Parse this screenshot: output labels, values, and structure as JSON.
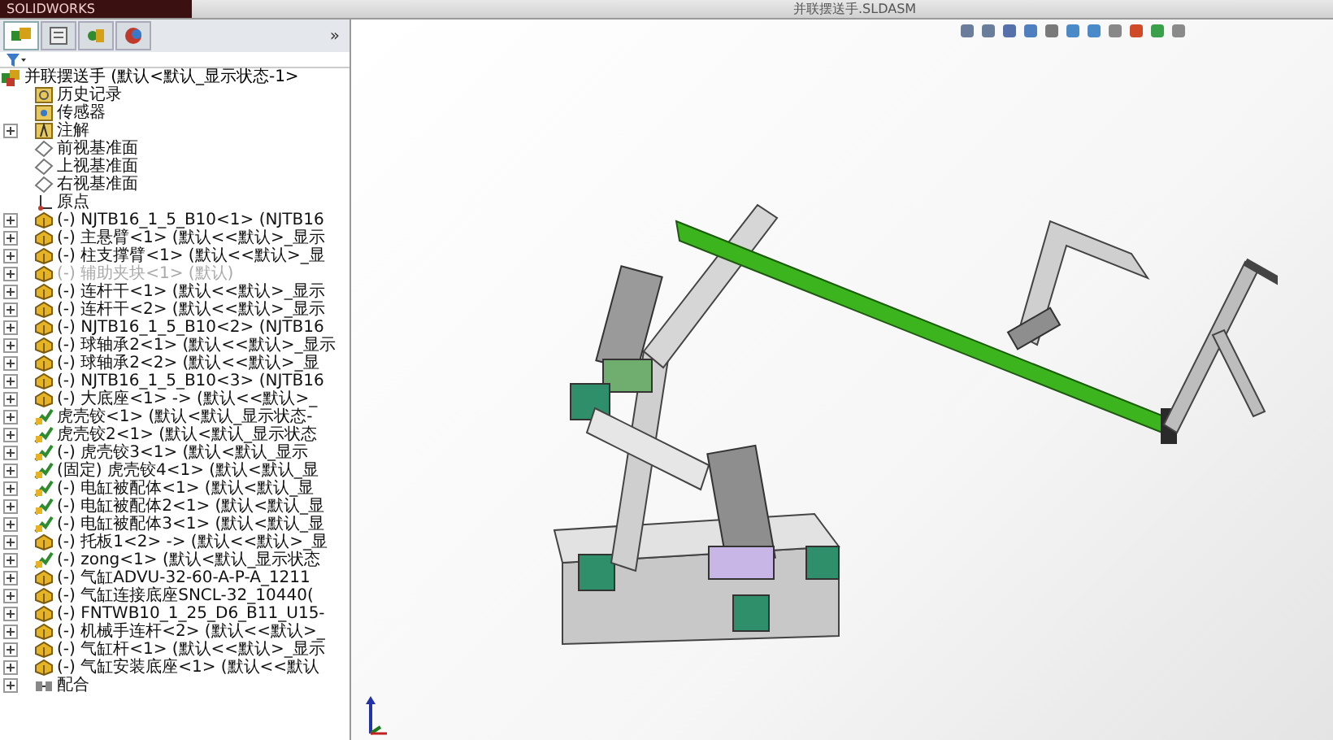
{
  "app": {
    "logo": "SOLIDWORKS",
    "title": "并联摆送手.SLDASM"
  },
  "panel_tabs": [
    {
      "kind": "tree",
      "selected": true
    },
    {
      "kind": "property",
      "selected": false
    },
    {
      "kind": "config",
      "selected": false
    },
    {
      "kind": "display",
      "selected": false
    }
  ],
  "panel_collapse": "»",
  "tree": {
    "label": "并联摆送手 (默认<默认_显示状态-1>",
    "kind": "assembly",
    "children": [
      {
        "label": "历史记录",
        "kind": "history",
        "expandable": false
      },
      {
        "label": "传感器",
        "kind": "sensor",
        "expandable": false
      },
      {
        "label": "注解",
        "kind": "annotation",
        "expandable": true
      },
      {
        "label": "前视基准面",
        "kind": "plane",
        "expandable": false
      },
      {
        "label": "上视基准面",
        "kind": "plane",
        "expandable": false
      },
      {
        "label": "右视基准面",
        "kind": "plane",
        "expandable": false
      },
      {
        "label": "原点",
        "kind": "origin",
        "expandable": false
      },
      {
        "label": "(-) NJTB16_1_5_B10<1> (NJTB16",
        "kind": "part",
        "expandable": true,
        "suppressed": false
      },
      {
        "label": "(-) 主悬臂<1> (默认<<默认>_显示",
        "kind": "part",
        "expandable": true,
        "suppressed": false
      },
      {
        "label": "(-) 柱支撑臂<1> (默认<<默认>_显",
        "kind": "part",
        "expandable": true,
        "suppressed": false
      },
      {
        "label": "(-) 辅助夹块<1> (默认)",
        "kind": "part",
        "expandable": true,
        "suppressed": true
      },
      {
        "label": "(-) 连杆干<1> (默认<<默认>_显示",
        "kind": "part",
        "expandable": true,
        "suppressed": false
      },
      {
        "label": "(-) 连杆干<2> (默认<<默认>_显示",
        "kind": "part",
        "expandable": true,
        "suppressed": false
      },
      {
        "label": "(-) NJTB16_1_5_B10<2> (NJTB16",
        "kind": "part",
        "expandable": true,
        "suppressed": false
      },
      {
        "label": "(-) 球轴承2<1> (默认<<默认>_显示",
        "kind": "part",
        "expandable": true,
        "suppressed": false
      },
      {
        "label": "(-) 球轴承2<2> (默认<<默认>_显",
        "kind": "part",
        "expandable": true,
        "suppressed": false
      },
      {
        "label": "(-) NJTB16_1_5_B10<3> (NJTB16",
        "kind": "part",
        "expandable": true,
        "suppressed": false
      },
      {
        "label": "(-) 大底座<1> -> (默认<<默认>_",
        "kind": "part",
        "expandable": true,
        "suppressed": false
      },
      {
        "label": "虎壳铰<1> (默认<默认_显示状态-",
        "kind": "subassembly",
        "expandable": true,
        "suppressed": false
      },
      {
        "label": "虎壳铰2<1> (默认<默认_显示状态",
        "kind": "subassembly",
        "expandable": true,
        "suppressed": false
      },
      {
        "label": "(-) 虎壳铰3<1> (默认<默认_显示",
        "kind": "subassembly",
        "expandable": true,
        "suppressed": false
      },
      {
        "label": "(固定) 虎壳铰4<1> (默认<默认_显",
        "kind": "subassembly",
        "expandable": true,
        "suppressed": false
      },
      {
        "label": "(-) 电缸被配体<1> (默认<默认_显",
        "kind": "subassembly",
        "expandable": true,
        "suppressed": false
      },
      {
        "label": "(-) 电缸被配体2<1> (默认<默认_显",
        "kind": "subassembly",
        "expandable": true,
        "suppressed": false
      },
      {
        "label": "(-) 电缸被配体3<1> (默认<默认_显",
        "kind": "subassembly",
        "expandable": true,
        "suppressed": false
      },
      {
        "label": "(-) 托板1<2> -> (默认<<默认>_显",
        "kind": "part",
        "expandable": true,
        "suppressed": false
      },
      {
        "label": "(-) zong<1> (默认<默认_显示状态",
        "kind": "subassembly",
        "expandable": true,
        "suppressed": false
      },
      {
        "label": "(-) 气缸ADVU-32-60-A-P-A_1211",
        "kind": "part",
        "expandable": true,
        "suppressed": false
      },
      {
        "label": "(-) 气缸连接底座SNCL-32_10440(",
        "kind": "part",
        "expandable": true,
        "suppressed": false
      },
      {
        "label": "(-) FNTWB10_1_25_D6_B11_U15-",
        "kind": "part",
        "expandable": true,
        "suppressed": false
      },
      {
        "label": "(-) 机械手连杆<2> (默认<<默认>_",
        "kind": "part",
        "expandable": true,
        "suppressed": false
      },
      {
        "label": "(-) 气缸杆<1> (默认<<默认>_显示",
        "kind": "part",
        "expandable": true,
        "suppressed": false
      },
      {
        "label": "(-) 气缸安装底座<1> (默认<<默认",
        "kind": "part",
        "expandable": true,
        "suppressed": false
      },
      {
        "label": "配合",
        "kind": "mates",
        "expandable": true
      }
    ]
  }
}
